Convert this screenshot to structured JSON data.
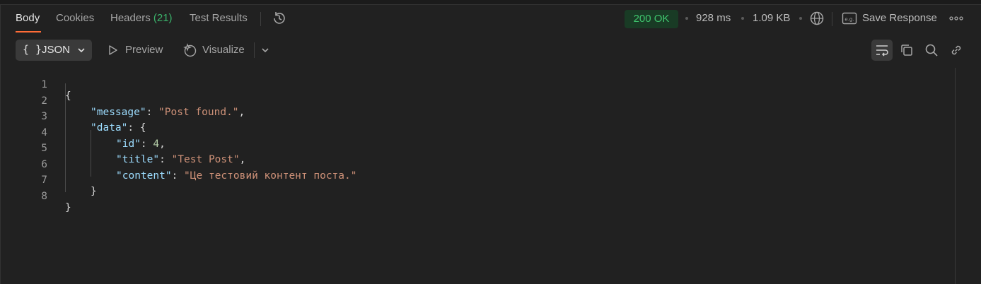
{
  "tabs": {
    "body": "Body",
    "cookies": "Cookies",
    "headers": "Headers",
    "headers_count": "(21)",
    "test_results": "Test Results"
  },
  "status": {
    "code": "200 OK",
    "time": "928 ms",
    "size": "1.09 KB",
    "save_label": "Save Response"
  },
  "toolbar": {
    "format_braces": "{ }",
    "format": "JSON",
    "preview": "Preview",
    "visualize": "Visualize"
  },
  "code_lines": [
    {
      "n": "1",
      "text": "{"
    },
    {
      "n": "2",
      "key": "\"message\"",
      "sep": ": ",
      "value": "\"Post found.\"",
      "end": ","
    },
    {
      "n": "3",
      "key": "\"data\"",
      "sep": ": ",
      "open": "{"
    },
    {
      "n": "4",
      "key": "\"id\"",
      "sep": ": ",
      "num": "4",
      "end": ","
    },
    {
      "n": "5",
      "key": "\"title\"",
      "sep": ": ",
      "value": "\"Test Post\"",
      "end": ","
    },
    {
      "n": "6",
      "key": "\"content\"",
      "sep": ": ",
      "value": "\"Це тестовий контент поста.\""
    },
    {
      "n": "7",
      "text": "}"
    },
    {
      "n": "8",
      "text": "}"
    }
  ],
  "colors": {
    "accent": "#ff6c37",
    "status_ok": "#3fc56e",
    "key": "#9cdcfe",
    "string": "#ce9178",
    "number": "#b5cea8"
  }
}
